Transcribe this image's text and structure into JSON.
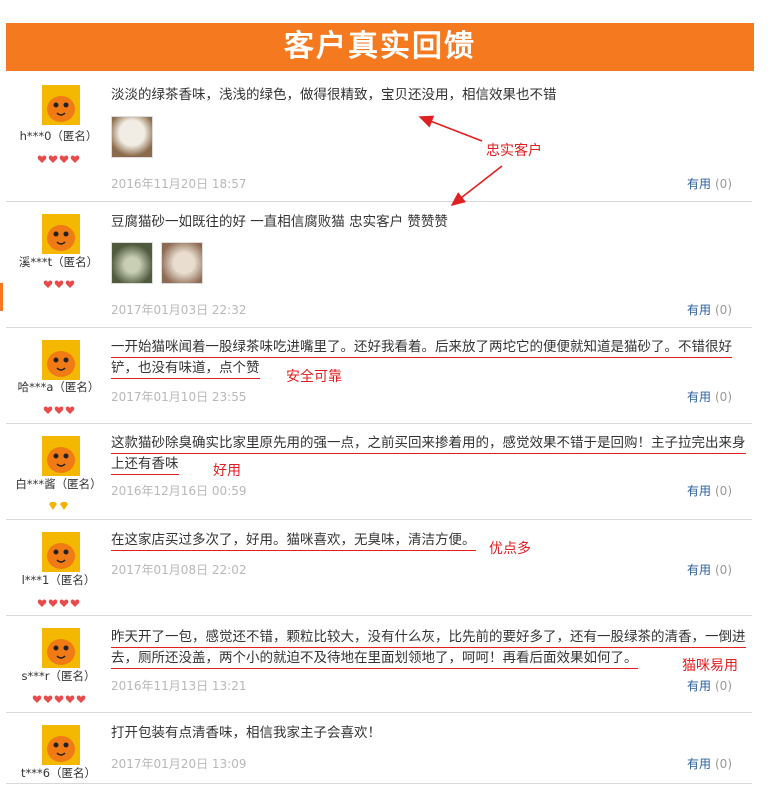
{
  "banner": {
    "title": "客户真实回馈"
  },
  "annotations": {
    "loyal_customer": "忠实客户",
    "safe_reliable": "安全可靠",
    "easy_to_use": "好用",
    "many_advantages": "优点多",
    "cat_easy_use": "猫咪易用"
  },
  "useful_label": "有用",
  "reviews": [
    {
      "user": "h***0（匿名）",
      "text": "淡淡的绿茶香味，浅浅的绿色，做得很精致，宝贝还没用，相信效果也不错",
      "date": "2016年11月20日 18:57",
      "useful_count": "(0)",
      "badge_count": 4,
      "badge_color": "#e84b4b",
      "has_images": true
    },
    {
      "user": "溪***t（匿名）",
      "text": "豆腐猫砂一如既往的好 一直相信腐败猫 忠实客户 赞赞赞",
      "date": "2017年01月03日 22:32",
      "useful_count": "(0)",
      "badge_count": 3,
      "badge_color": "#e84b4b",
      "has_images": true
    },
    {
      "user": "哈***a（匿名）",
      "text": "一开始猫咪闻着一股绿茶味吃进嘴里了。还好我看着。后来放了两坨它的便便就知道是猫砂了。不错很好铲，也没有味道，点个赞",
      "date": "2017年01月10日 23:55",
      "useful_count": "(0)",
      "badge_count": 3,
      "badge_color": "#e84b4b"
    },
    {
      "user": "白***酱（匿名）",
      "text": "这款猫砂除臭确实比家里原先用的强一点，之前买回来掺着用的，感觉效果不错于是回购！主子拉完出来身上还有香味",
      "date": "2016年12月16日 00:59",
      "useful_count": "(0)",
      "badge_count": 2,
      "badge_color": "#f2b300"
    },
    {
      "user": "l***1（匿名）",
      "text": "在这家店买过多次了，好用。猫咪喜欢，无臭味，清洁方便。",
      "date": "2017年01月08日 22:02",
      "useful_count": "(0)",
      "badge_count": 4,
      "badge_color": "#e84b4b"
    },
    {
      "user": "s***r（匿名）",
      "text": "昨天开了一包，感觉还不错，颗粒比较大，没有什么灰，比先前的要好多了，还有一股绿茶的清香，一倒进去，厕所还没盖，两个小的就迫不及待地在里面划领地了，呵呵！再看后面效果如何了。",
      "date": "2016年11月13日 13:21",
      "useful_count": "(0)",
      "badge_count": 5,
      "badge_color": "#e84b4b"
    },
    {
      "user": "t***6（匿名）",
      "text": "打开包装有点清香味，相信我家主子会喜欢！",
      "date": "2017年01月20日 13:09",
      "useful_count": "(0)",
      "badge_count": 0,
      "badge_color": "#e84b4b"
    }
  ],
  "colors": {
    "banner": "#f5791f",
    "annotation": "#e02020",
    "link": "#2a5f9e"
  }
}
